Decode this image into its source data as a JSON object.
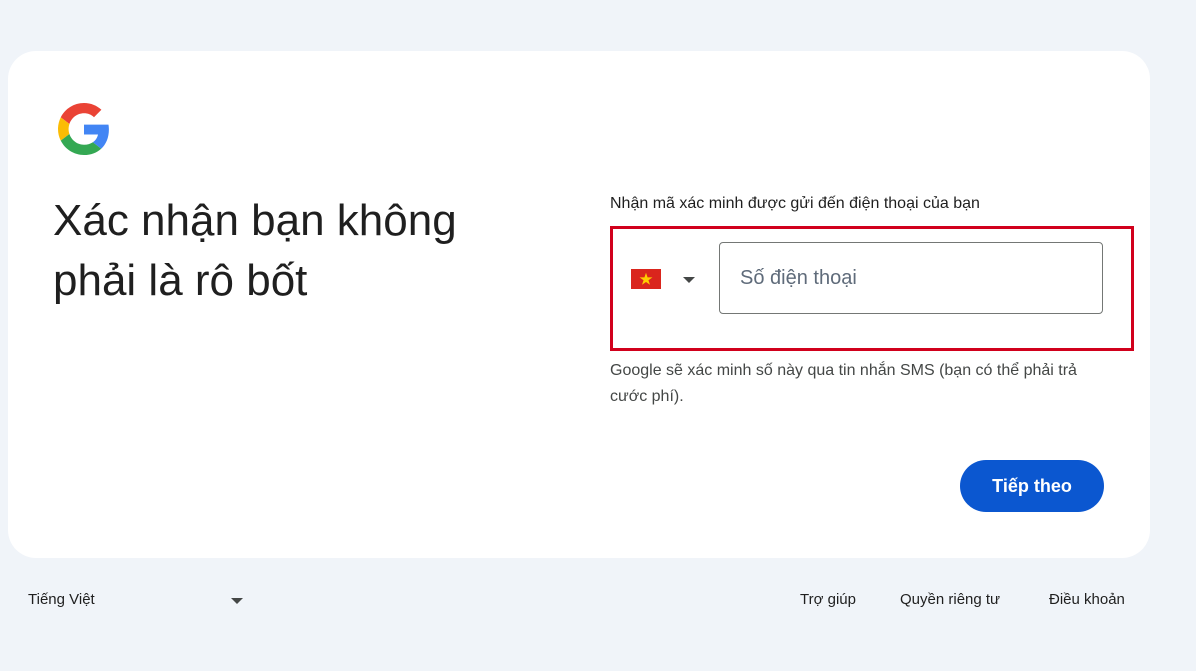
{
  "colors": {
    "page_background": "#f0f4f9",
    "card_background": "#ffffff",
    "primary_button": "#0b57d0",
    "highlight_border": "#d1001c",
    "flag_red": "#da251d",
    "flag_star": "#ffcd00"
  },
  "logo": {
    "icon": "google-g-logo"
  },
  "heading": {
    "line1": "Xác nhận bạn không",
    "line2": "phải là rô bốt"
  },
  "form": {
    "instruction": "Nhận mã xác minh được gửi đến điện thoại của bạn",
    "country": {
      "flag_icon": "vietnam-flag-icon",
      "caret_icon": "caret-down-icon"
    },
    "phone_input": {
      "value": "",
      "placeholder": "Số điện thoại"
    },
    "sms_note": "Google sẽ xác minh số này qua tin nhắn SMS (bạn có thể phải trả cước phí).",
    "next_button": "Tiếp theo"
  },
  "footer": {
    "language": "Tiếng Việt",
    "links": {
      "help": "Trợ giúp",
      "privacy": "Quyền riêng tư",
      "terms": "Điều khoản"
    }
  }
}
